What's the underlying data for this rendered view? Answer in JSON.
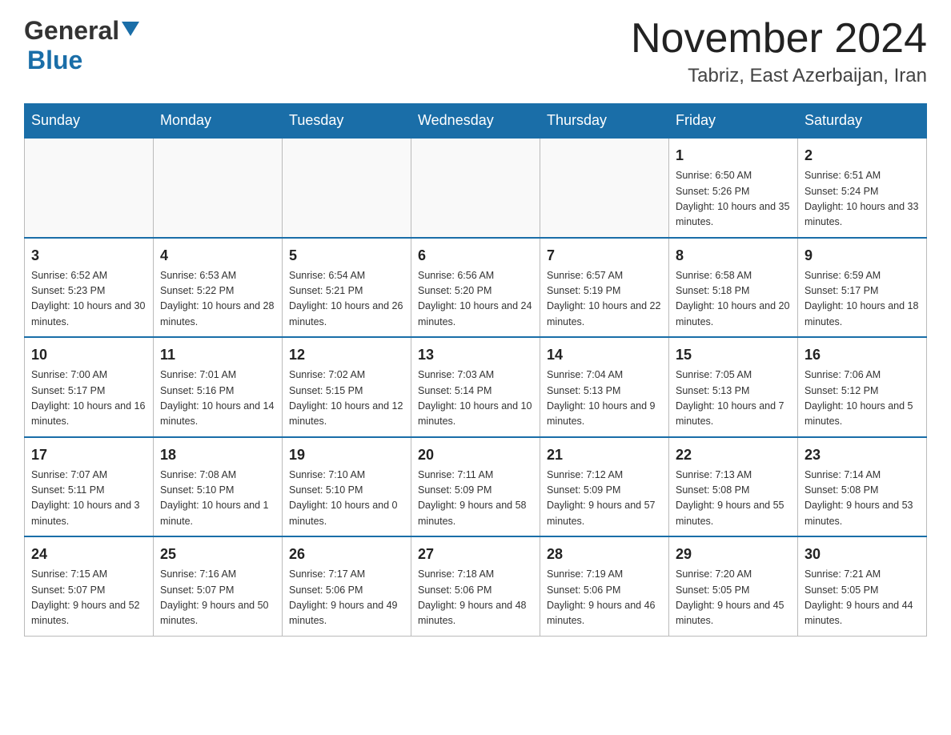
{
  "header": {
    "logo_line1": "General",
    "logo_line2": "Blue",
    "month_title": "November 2024",
    "location": "Tabriz, East Azerbaijan, Iran"
  },
  "weekdays": [
    "Sunday",
    "Monday",
    "Tuesday",
    "Wednesday",
    "Thursday",
    "Friday",
    "Saturday"
  ],
  "weeks": [
    [
      {
        "day": "",
        "sunrise": "",
        "sunset": "",
        "daylight": ""
      },
      {
        "day": "",
        "sunrise": "",
        "sunset": "",
        "daylight": ""
      },
      {
        "day": "",
        "sunrise": "",
        "sunset": "",
        "daylight": ""
      },
      {
        "day": "",
        "sunrise": "",
        "sunset": "",
        "daylight": ""
      },
      {
        "day": "",
        "sunrise": "",
        "sunset": "",
        "daylight": ""
      },
      {
        "day": "1",
        "sunrise": "Sunrise: 6:50 AM",
        "sunset": "Sunset: 5:26 PM",
        "daylight": "Daylight: 10 hours and 35 minutes."
      },
      {
        "day": "2",
        "sunrise": "Sunrise: 6:51 AM",
        "sunset": "Sunset: 5:24 PM",
        "daylight": "Daylight: 10 hours and 33 minutes."
      }
    ],
    [
      {
        "day": "3",
        "sunrise": "Sunrise: 6:52 AM",
        "sunset": "Sunset: 5:23 PM",
        "daylight": "Daylight: 10 hours and 30 minutes."
      },
      {
        "day": "4",
        "sunrise": "Sunrise: 6:53 AM",
        "sunset": "Sunset: 5:22 PM",
        "daylight": "Daylight: 10 hours and 28 minutes."
      },
      {
        "day": "5",
        "sunrise": "Sunrise: 6:54 AM",
        "sunset": "Sunset: 5:21 PM",
        "daylight": "Daylight: 10 hours and 26 minutes."
      },
      {
        "day": "6",
        "sunrise": "Sunrise: 6:56 AM",
        "sunset": "Sunset: 5:20 PM",
        "daylight": "Daylight: 10 hours and 24 minutes."
      },
      {
        "day": "7",
        "sunrise": "Sunrise: 6:57 AM",
        "sunset": "Sunset: 5:19 PM",
        "daylight": "Daylight: 10 hours and 22 minutes."
      },
      {
        "day": "8",
        "sunrise": "Sunrise: 6:58 AM",
        "sunset": "Sunset: 5:18 PM",
        "daylight": "Daylight: 10 hours and 20 minutes."
      },
      {
        "day": "9",
        "sunrise": "Sunrise: 6:59 AM",
        "sunset": "Sunset: 5:17 PM",
        "daylight": "Daylight: 10 hours and 18 minutes."
      }
    ],
    [
      {
        "day": "10",
        "sunrise": "Sunrise: 7:00 AM",
        "sunset": "Sunset: 5:17 PM",
        "daylight": "Daylight: 10 hours and 16 minutes."
      },
      {
        "day": "11",
        "sunrise": "Sunrise: 7:01 AM",
        "sunset": "Sunset: 5:16 PM",
        "daylight": "Daylight: 10 hours and 14 minutes."
      },
      {
        "day": "12",
        "sunrise": "Sunrise: 7:02 AM",
        "sunset": "Sunset: 5:15 PM",
        "daylight": "Daylight: 10 hours and 12 minutes."
      },
      {
        "day": "13",
        "sunrise": "Sunrise: 7:03 AM",
        "sunset": "Sunset: 5:14 PM",
        "daylight": "Daylight: 10 hours and 10 minutes."
      },
      {
        "day": "14",
        "sunrise": "Sunrise: 7:04 AM",
        "sunset": "Sunset: 5:13 PM",
        "daylight": "Daylight: 10 hours and 9 minutes."
      },
      {
        "day": "15",
        "sunrise": "Sunrise: 7:05 AM",
        "sunset": "Sunset: 5:13 PM",
        "daylight": "Daylight: 10 hours and 7 minutes."
      },
      {
        "day": "16",
        "sunrise": "Sunrise: 7:06 AM",
        "sunset": "Sunset: 5:12 PM",
        "daylight": "Daylight: 10 hours and 5 minutes."
      }
    ],
    [
      {
        "day": "17",
        "sunrise": "Sunrise: 7:07 AM",
        "sunset": "Sunset: 5:11 PM",
        "daylight": "Daylight: 10 hours and 3 minutes."
      },
      {
        "day": "18",
        "sunrise": "Sunrise: 7:08 AM",
        "sunset": "Sunset: 5:10 PM",
        "daylight": "Daylight: 10 hours and 1 minute."
      },
      {
        "day": "19",
        "sunrise": "Sunrise: 7:10 AM",
        "sunset": "Sunset: 5:10 PM",
        "daylight": "Daylight: 10 hours and 0 minutes."
      },
      {
        "day": "20",
        "sunrise": "Sunrise: 7:11 AM",
        "sunset": "Sunset: 5:09 PM",
        "daylight": "Daylight: 9 hours and 58 minutes."
      },
      {
        "day": "21",
        "sunrise": "Sunrise: 7:12 AM",
        "sunset": "Sunset: 5:09 PM",
        "daylight": "Daylight: 9 hours and 57 minutes."
      },
      {
        "day": "22",
        "sunrise": "Sunrise: 7:13 AM",
        "sunset": "Sunset: 5:08 PM",
        "daylight": "Daylight: 9 hours and 55 minutes."
      },
      {
        "day": "23",
        "sunrise": "Sunrise: 7:14 AM",
        "sunset": "Sunset: 5:08 PM",
        "daylight": "Daylight: 9 hours and 53 minutes."
      }
    ],
    [
      {
        "day": "24",
        "sunrise": "Sunrise: 7:15 AM",
        "sunset": "Sunset: 5:07 PM",
        "daylight": "Daylight: 9 hours and 52 minutes."
      },
      {
        "day": "25",
        "sunrise": "Sunrise: 7:16 AM",
        "sunset": "Sunset: 5:07 PM",
        "daylight": "Daylight: 9 hours and 50 minutes."
      },
      {
        "day": "26",
        "sunrise": "Sunrise: 7:17 AM",
        "sunset": "Sunset: 5:06 PM",
        "daylight": "Daylight: 9 hours and 49 minutes."
      },
      {
        "day": "27",
        "sunrise": "Sunrise: 7:18 AM",
        "sunset": "Sunset: 5:06 PM",
        "daylight": "Daylight: 9 hours and 48 minutes."
      },
      {
        "day": "28",
        "sunrise": "Sunrise: 7:19 AM",
        "sunset": "Sunset: 5:06 PM",
        "daylight": "Daylight: 9 hours and 46 minutes."
      },
      {
        "day": "29",
        "sunrise": "Sunrise: 7:20 AM",
        "sunset": "Sunset: 5:05 PM",
        "daylight": "Daylight: 9 hours and 45 minutes."
      },
      {
        "day": "30",
        "sunrise": "Sunrise: 7:21 AM",
        "sunset": "Sunset: 5:05 PM",
        "daylight": "Daylight: 9 hours and 44 minutes."
      }
    ]
  ]
}
